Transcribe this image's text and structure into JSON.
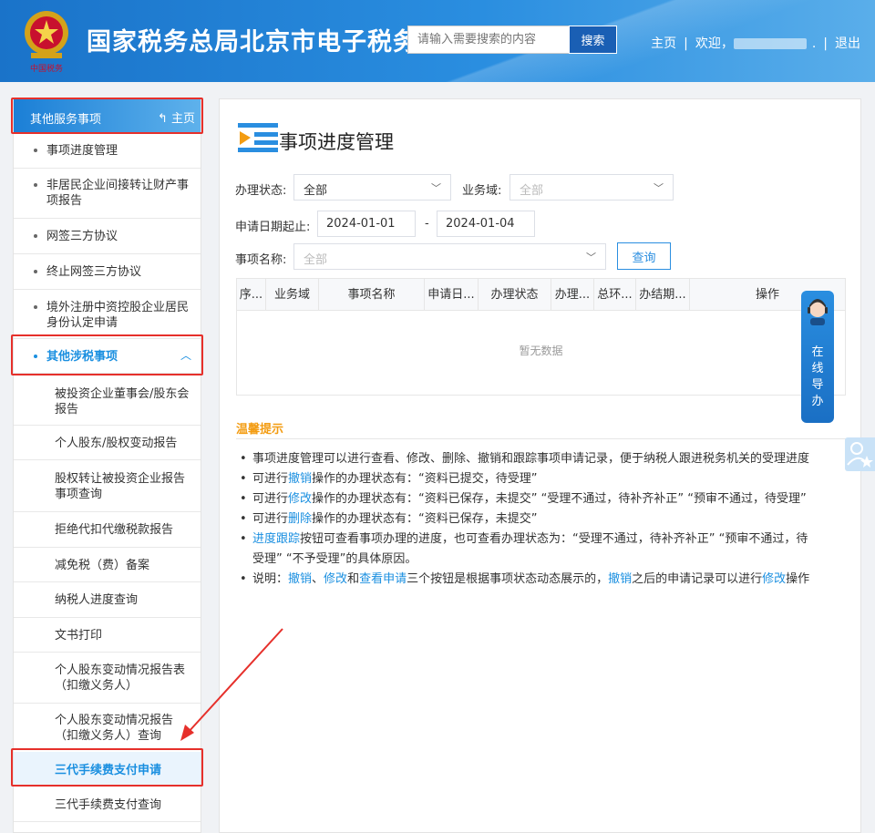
{
  "header": {
    "site_title": "国家税务总局北京市电子税务",
    "search_placeholder": "请输入需要搜索的内容",
    "search_label": "搜索",
    "home_link": "主页",
    "welcome": "欢迎，",
    "logout": "退出",
    "brand_color": "#1a73c9"
  },
  "sidebar": {
    "header_title": "其他服务事项",
    "header_home": "主页",
    "items": [
      {
        "label": "事项进度管理"
      },
      {
        "label": "非居民企业间接转让财产事项报告"
      },
      {
        "label": "网签三方协议"
      },
      {
        "label": "终止网签三方协议"
      },
      {
        "label": "境外注册中资控股企业居民身份认定申请"
      },
      {
        "label": "其他涉税事项"
      }
    ],
    "sub_items": [
      {
        "label": "被投资企业董事会/股东会报告"
      },
      {
        "label": "个人股东/股权变动报告"
      },
      {
        "label": "股权转让被投资企业报告事项查询"
      },
      {
        "label": "拒绝代扣代缴税款报告"
      },
      {
        "label": "减免税（费）备案"
      },
      {
        "label": "纳税人进度查询"
      },
      {
        "label": "文书打印"
      },
      {
        "label": "个人股东变动情况报告表（扣缴义务人）"
      },
      {
        "label": "个人股东变动情况报告（扣缴义务人）查询"
      },
      {
        "label": "三代手续费支付申请"
      },
      {
        "label": "三代手续费支付查询"
      }
    ]
  },
  "main": {
    "title": "事项进度管理",
    "filters": {
      "status_label": "办理状态:",
      "status_value": "全部",
      "domain_label": "业务域:",
      "domain_placeholder": "全部",
      "date_label": "申请日期起止:",
      "date_start": "2024-01-01",
      "date_sep": "-",
      "date_end": "2024-01-04",
      "item_label": "事项名称:",
      "item_placeholder": "全部",
      "query_label": "查询"
    },
    "table": {
      "columns": [
        "序...",
        "业务域",
        "事项名称",
        "申请日...",
        "办理状态",
        "办理...",
        "总环...",
        "办结期...",
        "操作"
      ],
      "empty_text": "暂无数据"
    },
    "tips": {
      "title": "温馨提示",
      "lines": [
        {
          "parts": [
            {
              "t": "事项进度管理可以进行查看、修改、删除、撤销和跟踪事项申请记录，便于纳税人跟进税务机关的受理进度"
            }
          ]
        },
        {
          "parts": [
            {
              "t": "可进行"
            },
            {
              "t": "撤销",
              "hl": true
            },
            {
              "t": "操作的办理状态有：“资料已提交，待受理”"
            }
          ]
        },
        {
          "parts": [
            {
              "t": "可进行"
            },
            {
              "t": "修改",
              "hl": true
            },
            {
              "t": "操作的办理状态有：“资料已保存，未提交”  “受理不通过，待补齐补正”  “预审不通过，待受理”"
            }
          ]
        },
        {
          "parts": [
            {
              "t": "可进行"
            },
            {
              "t": "删除",
              "hl": true
            },
            {
              "t": "操作的办理状态有：“资料已保存，未提交”"
            }
          ]
        },
        {
          "parts": [
            {
              "t": "进度跟踪",
              "hl": true
            },
            {
              "t": "按钮可查看事项办理的进度，也可查看办理状态为：“受理不通过，待补齐补正”  “预审不通过，待受理”  “不予受理”的具体原因。"
            }
          ]
        },
        {
          "parts": [
            {
              "t": "说明："
            },
            {
              "t": "撤销",
              "hl": true
            },
            {
              "t": "、"
            },
            {
              "t": "修改",
              "hl": true
            },
            {
              "t": "和"
            },
            {
              "t": "查看申请",
              "hl": true
            },
            {
              "t": "三个按钮是根据事项状态动态展示的，"
            },
            {
              "t": "撤销",
              "hl": true
            },
            {
              "t": "之后的申请记录可以进行"
            },
            {
              "t": "修改",
              "hl": true
            },
            {
              "t": "操作"
            }
          ]
        }
      ]
    }
  },
  "float": {
    "guide_text": "在线导办"
  }
}
